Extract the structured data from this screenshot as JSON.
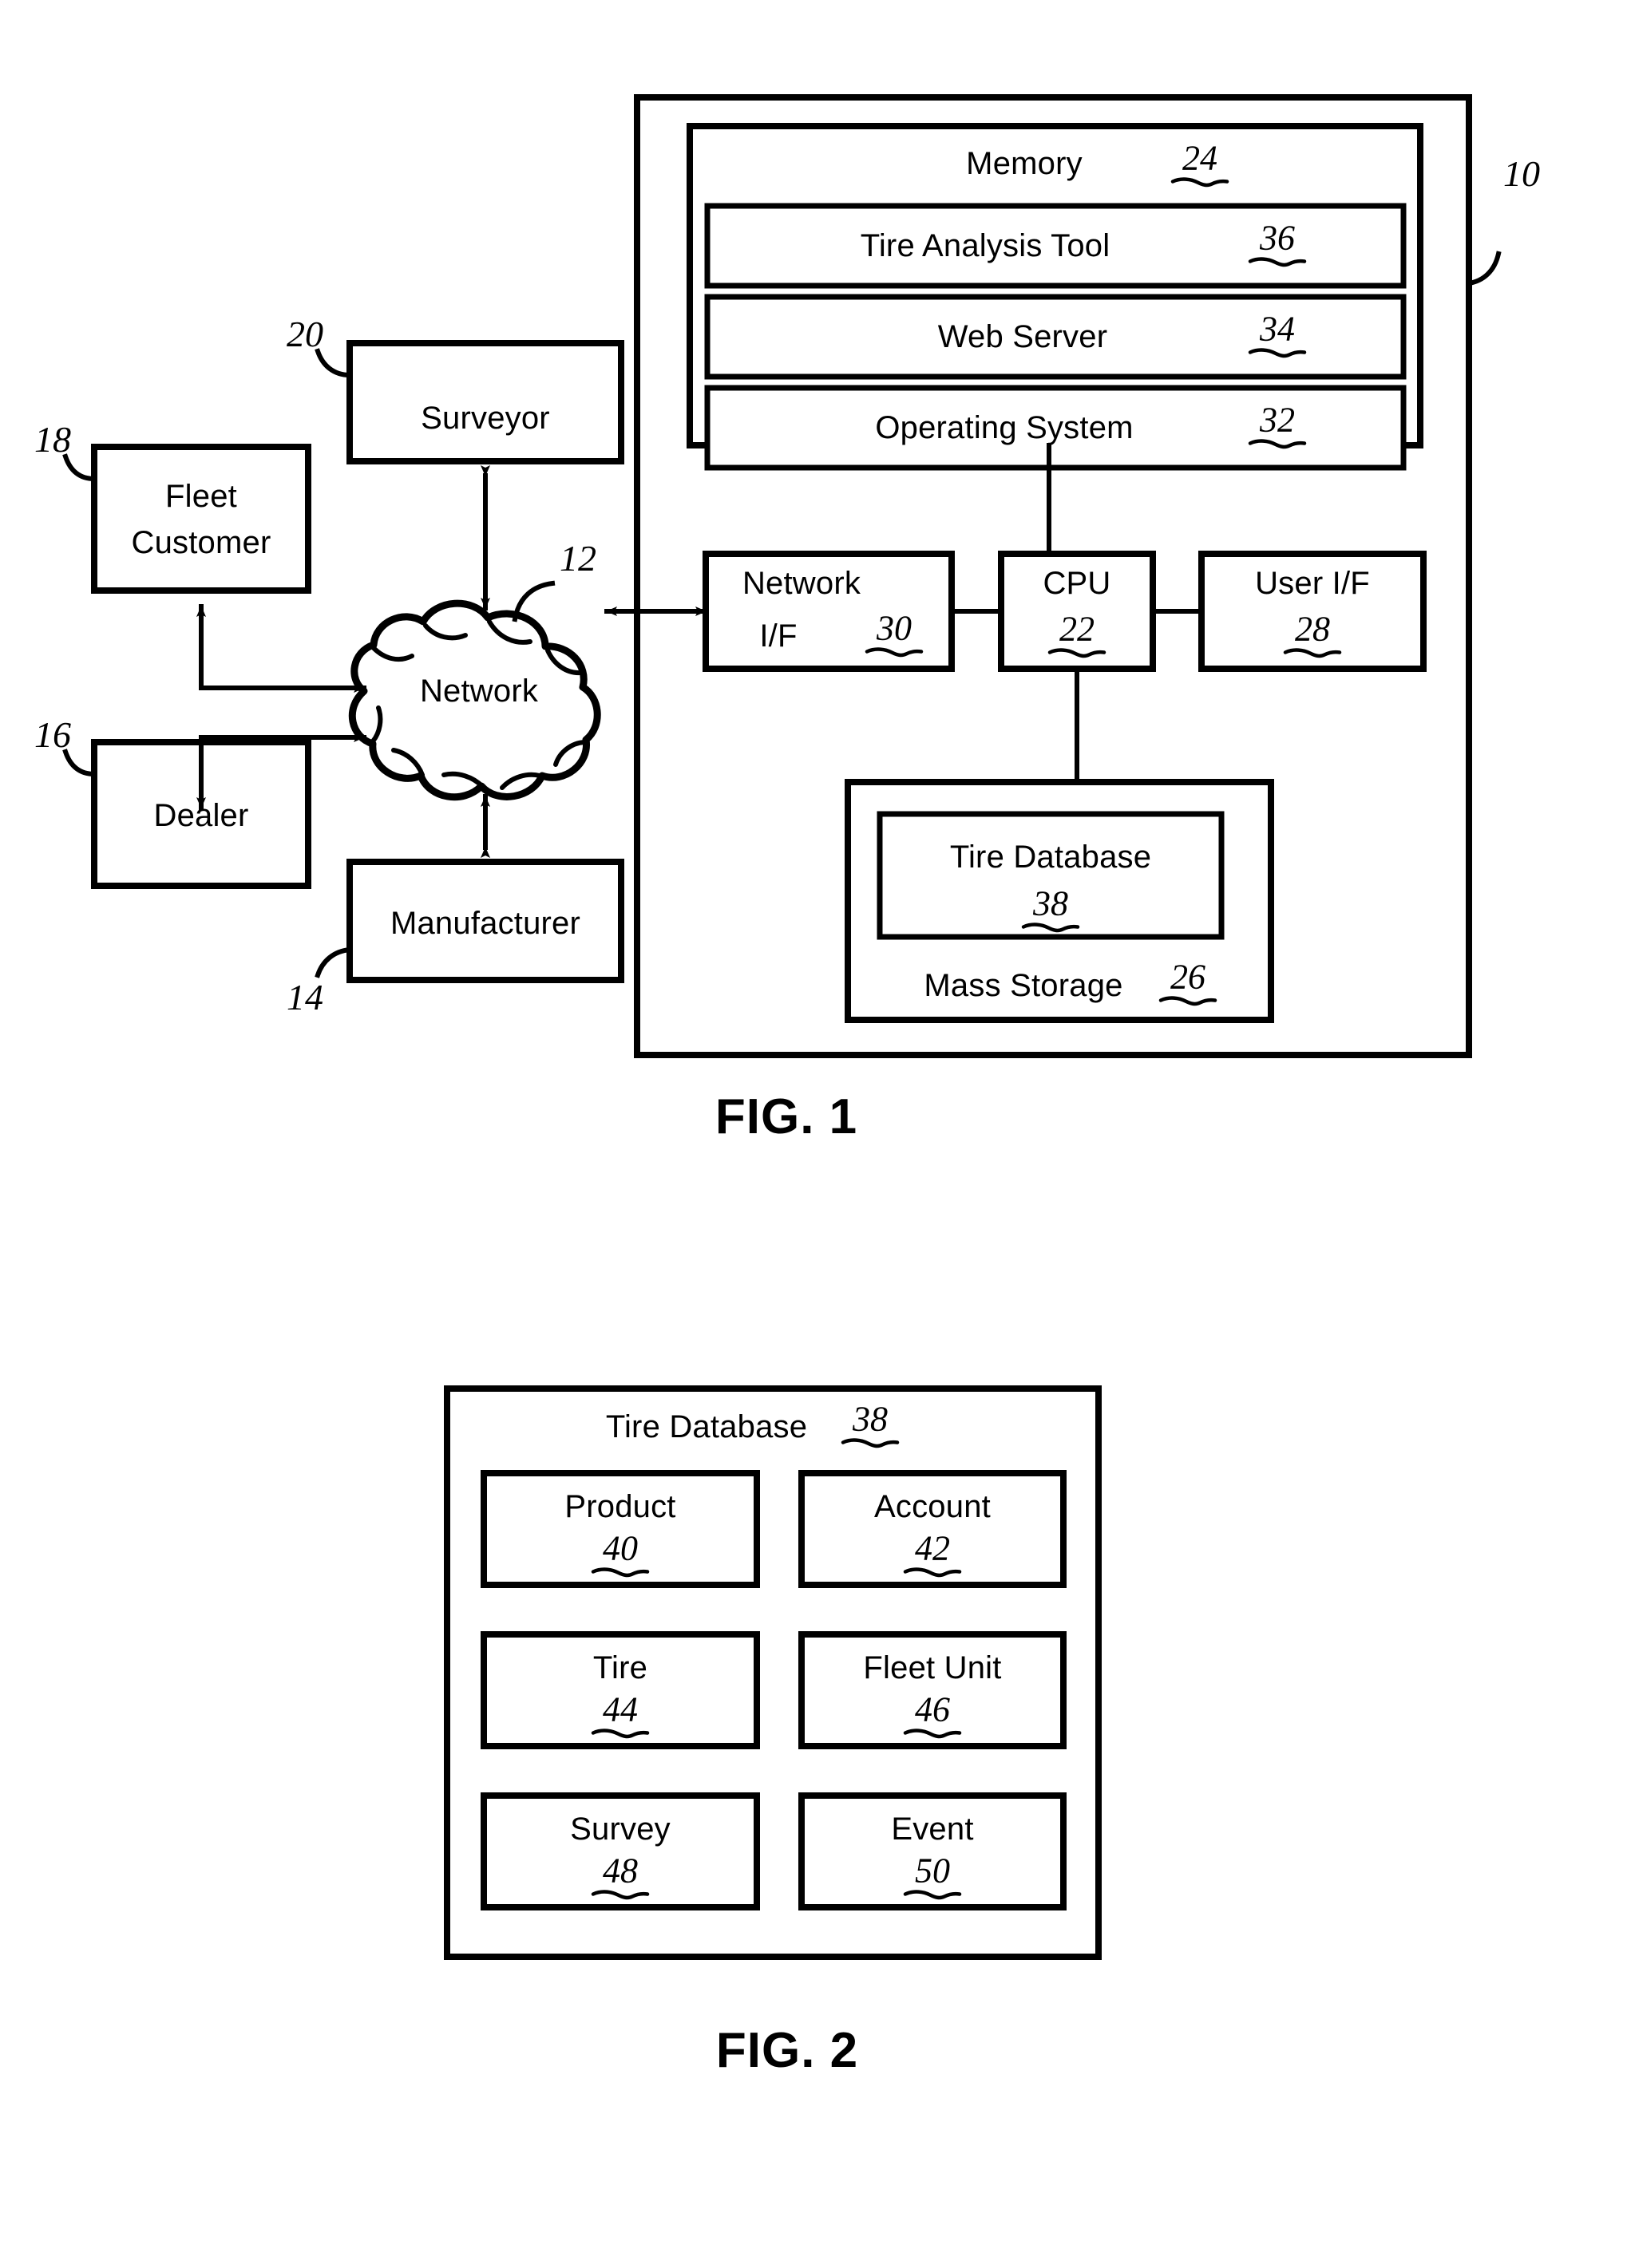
{
  "document": {
    "type": "patent-drawing-sheet",
    "figures": [
      "FIG. 1",
      "FIG. 2"
    ]
  },
  "figure1": {
    "caption": "FIG. 1",
    "system_ref": "10",
    "computer": {
      "memory": {
        "label": "Memory",
        "ref": "24",
        "modules": [
          {
            "label": "Tire Analysis Tool",
            "ref": "36"
          },
          {
            "label": "Web Server",
            "ref": "34"
          },
          {
            "label": "Operating System",
            "ref": "32"
          }
        ]
      },
      "network_if": {
        "label_line1": "Network",
        "label_line2": "I/F",
        "ref": "30"
      },
      "cpu": {
        "label": "CPU",
        "ref": "22"
      },
      "user_if": {
        "label": "User I/F",
        "ref": "28"
      },
      "mass_storage": {
        "label": "Mass Storage",
        "ref": "26",
        "tire_database": {
          "label": "Tire Database",
          "ref": "38"
        }
      }
    },
    "network": {
      "label": "Network",
      "ref": "12"
    },
    "actors": [
      {
        "label": "Surveyor",
        "ref": "20"
      },
      {
        "label_line1": "Fleet",
        "label_line2": "Customer",
        "ref": "18"
      },
      {
        "label": "Dealer",
        "ref": "16"
      },
      {
        "label": "Manufacturer",
        "ref": "14"
      }
    ]
  },
  "figure2": {
    "caption": "FIG. 2",
    "container": {
      "label": "Tire Database",
      "ref": "38"
    },
    "tables": [
      {
        "label": "Product",
        "ref": "40"
      },
      {
        "label": "Account",
        "ref": "42"
      },
      {
        "label": "Tire",
        "ref": "44"
      },
      {
        "label": "Fleet Unit",
        "ref": "46"
      },
      {
        "label": "Survey",
        "ref": "48"
      },
      {
        "label": "Event",
        "ref": "50"
      }
    ]
  },
  "style": {
    "ink": "#000000",
    "paper": "#ffffff"
  }
}
